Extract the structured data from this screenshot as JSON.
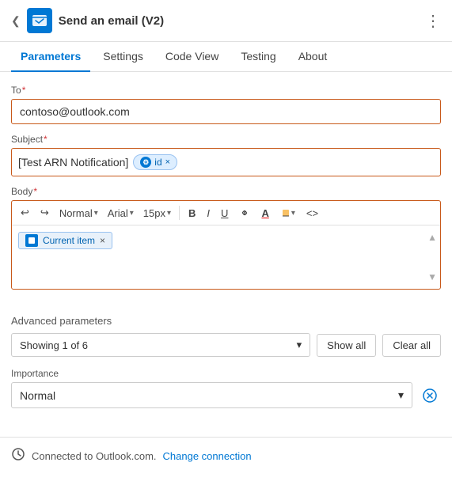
{
  "topBar": {
    "title": "Send an email (V2)",
    "chevron": "❮",
    "moreOptions": "⋮"
  },
  "tabs": [
    {
      "id": "parameters",
      "label": "Parameters",
      "active": true
    },
    {
      "id": "settings",
      "label": "Settings",
      "active": false
    },
    {
      "id": "codeview",
      "label": "Code View",
      "active": false
    },
    {
      "id": "testing",
      "label": "Testing",
      "active": false
    },
    {
      "id": "about",
      "label": "About",
      "active": false
    }
  ],
  "fields": {
    "to": {
      "label": "To",
      "required": "*",
      "value": "contoso@outlook.com"
    },
    "subject": {
      "label": "Subject",
      "required": "*",
      "prefixText": "[Test ARN Notification]",
      "token": {
        "label": "id",
        "closeChar": "×"
      }
    },
    "body": {
      "label": "Body",
      "required": "*"
    }
  },
  "toolbar": {
    "undo": "↩",
    "redo": "↪",
    "styleLabel": "Normal",
    "fontLabel": "Arial",
    "sizeLabel": "15px",
    "bold": "B",
    "italic": "I",
    "underline": "U",
    "link": "🔗",
    "fontColor": "A",
    "highlight": "🖍",
    "code": "<>"
  },
  "bodyToken": {
    "label": "Current item",
    "closeChar": "×"
  },
  "advanced": {
    "sectionLabel": "Advanced parameters",
    "dropdownValue": "Showing 1 of 6",
    "showAllBtn": "Show all",
    "clearAllBtn": "Clear all"
  },
  "importance": {
    "label": "Importance",
    "value": "Normal",
    "clearTitle": "Clear"
  },
  "footer": {
    "connectedText": "Connected to Outlook.com.",
    "changeLink": "Change connection"
  }
}
